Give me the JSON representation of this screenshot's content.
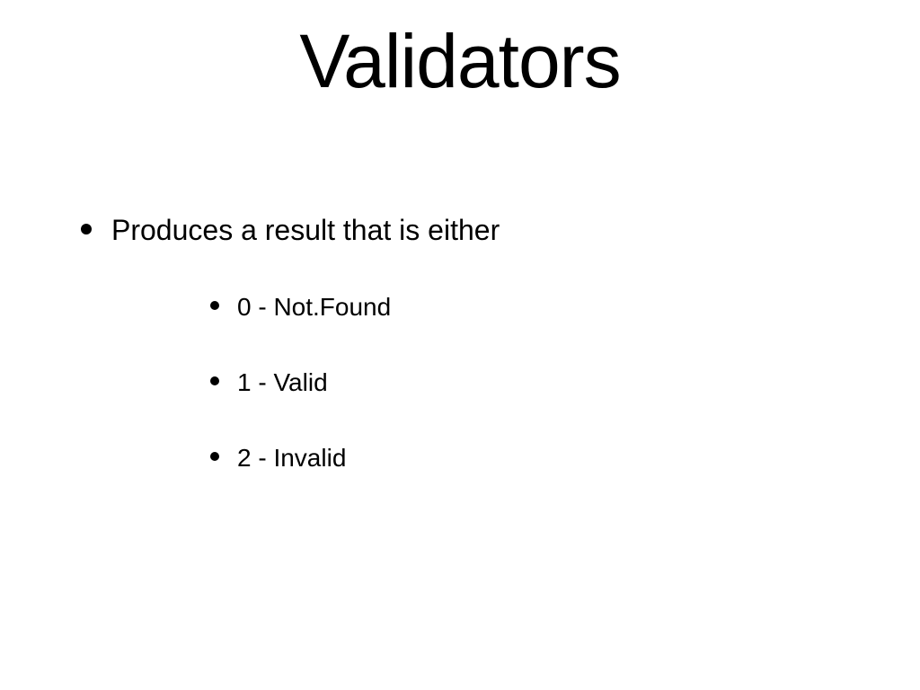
{
  "slide": {
    "title": "Validators",
    "bullet": {
      "text": "Produces a result that is either",
      "sub_items": [
        "0 - Not.Found",
        "1 - Valid",
        "2 - Invalid"
      ]
    }
  }
}
